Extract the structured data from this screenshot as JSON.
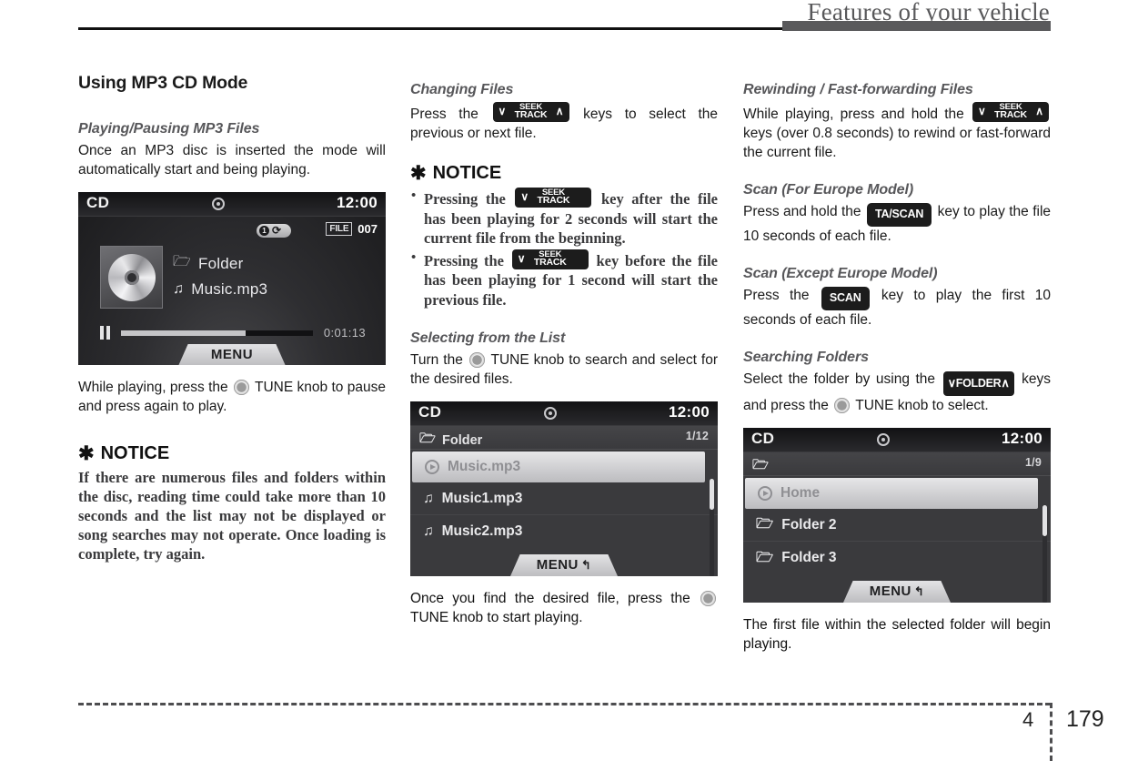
{
  "header": {
    "title": "Features of your vehicle"
  },
  "footer": {
    "chapter": "4",
    "page": "179"
  },
  "left": {
    "section_title": "Using MP3 CD Mode",
    "sub1_title": "Playing/Pausing MP3 Files",
    "sub1_body": "Once an MP3 disc is inserted the mode will automatically start and being playing.",
    "after_screen_body_1": "While playing, press the ",
    "after_screen_body_2": " TUNE knob to pause and press again to play.",
    "notice_label": "NOTICE",
    "notice_star": "✱",
    "notice_body": "If there are numerous files and folders within the disc, reading time could take more than 10 seconds and the list may not be displayed or song searches may not operate. Once loading is complete, try again."
  },
  "mid": {
    "sub1_title": "Changing Files",
    "sub1_body_1": "Press the ",
    "sub1_body_2": " keys to select the previous or next file.",
    "notice_label": "NOTICE",
    "notice_star": "✱",
    "bullet1_a": "Pressing the ",
    "bullet1_b": " key after the file has been playing for 2 seconds will start the current file from the beginning.",
    "bullet2_a": "Pressing the ",
    "bullet2_b": " key before the file has been playing for 1 second will start the previous file.",
    "sub2_title": "Selecting from the List",
    "sub2_body_1": "Turn the ",
    "sub2_body_2": " TUNE knob to search and select for the desired files.",
    "caption_1": "Once you find the desired file, press the ",
    "caption_2": " TUNE knob to start playing."
  },
  "right": {
    "sub1_title": "Rewinding / Fast-forwarding Files",
    "sub1_body_1": "While playing, press and hold the ",
    "sub1_body_2": " keys (over 0.8 seconds) to rewind or fast-forward the current file.",
    "sub2_title": "Scan (For Europe Model)",
    "sub2_body_1": "Press and hold the ",
    "sub2_body_2": " key to play the file 10 seconds of each file.",
    "sub3_title": "Scan (Except Europe Model)",
    "sub3_body_1": "Press the ",
    "sub3_body_2": " key to play the first 10 seconds of each file.",
    "sub4_title": "Searching Folders",
    "sub4_body_1": "Select the folder by using the ",
    "sub4_body_2": " keys and press the ",
    "sub4_body_3": " TUNE knob to select.",
    "caption": "The first file within the selected folder will begin playing."
  },
  "keys": {
    "seek_top": "SEEK",
    "seek_bottom": "TRACK",
    "arrow_down": "∨",
    "arrow_up": "∧",
    "ta_scan": "TA/SCAN",
    "scan": "SCAN",
    "folder": "FOLDER"
  },
  "screen_player": {
    "source": "CD",
    "clock": "12:00",
    "repeat_mode": "1",
    "repeat_icon": "⟳",
    "file_label": "FILE",
    "file_number": "007",
    "folder_name": "Folder",
    "track_name": "Music.mp3",
    "elapsed": "0:01:13",
    "progress_percent": 65,
    "menu_label": "MENU",
    "folder_icon": "🗁",
    "note_icon": "♫"
  },
  "screen_list_files": {
    "source": "CD",
    "clock": "12:00",
    "header_name": "Folder",
    "counter": "1/12",
    "rows": [
      {
        "label": "Music.mp3",
        "icon": "play-circle",
        "selected": true
      },
      {
        "label": "Music1.mp3",
        "icon": "note",
        "selected": false
      },
      {
        "label": "Music2.mp3",
        "icon": "note",
        "selected": false
      }
    ],
    "menu_label": "MENU",
    "menu_back_icon": "↰"
  },
  "screen_list_folders": {
    "source": "CD",
    "clock": "12:00",
    "header_name": "",
    "counter": "1/9",
    "rows": [
      {
        "label": "Home",
        "icon": "play-circle",
        "selected": true
      },
      {
        "label": "Folder 2",
        "icon": "folder",
        "selected": false
      },
      {
        "label": "Folder 3",
        "icon": "folder",
        "selected": false
      }
    ],
    "menu_label": "MENU",
    "menu_back_icon": "↰"
  },
  "colors": {
    "header_rule": "#5a5a5c",
    "heading_gray": "#57575a",
    "screen_bg": "#2c2c2e",
    "chip_bg": "#1c1c1c"
  }
}
